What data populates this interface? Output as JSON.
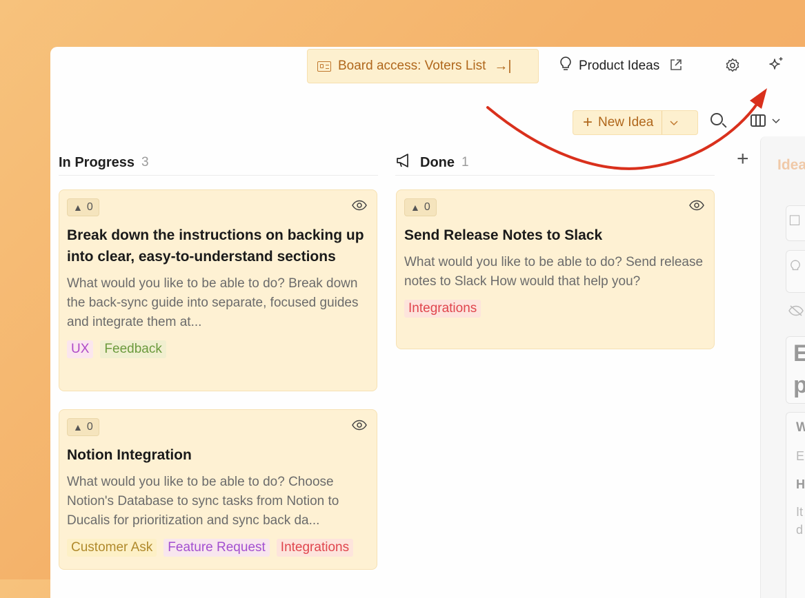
{
  "topbar": {
    "board_access_label": "Board access: Voters List",
    "board_access_icon": "id-card-icon",
    "board_access_arrow": "→|",
    "board_name": "Product Ideas",
    "board_icon": "lightbulb-icon",
    "external_icon": "external-link-icon",
    "settings_icon": "gear-icon",
    "ai_icon": "sparkle-icon"
  },
  "toolbar": {
    "new_idea_label": "New Idea",
    "search_icon": "search-icon",
    "columns_icon": "columns-icon"
  },
  "columns": [
    {
      "title": "In Progress",
      "count": "3"
    },
    {
      "title": "Done",
      "count": "1",
      "icon": "megaphone-icon"
    }
  ],
  "cards": [
    {
      "votes": "0",
      "title": "Break down the instructions on backing up into clear, easy-to-understand sections",
      "description": "What would you like to be able to do? Break down the back-sync guide into separate, focused guides and integrate them at...",
      "tags": [
        "UX",
        "Feedback"
      ]
    },
    {
      "votes": "0",
      "title": "Notion Integration",
      "description": "What would you like to be able to do? Choose Notion's Database to sync tasks from Notion to Ducalis for prioritization and sync back da...",
      "tags": [
        "Customer Ask",
        "Feature Request",
        "Integrations"
      ]
    },
    {
      "votes": "0",
      "title": "Send Release Notes to Slack",
      "description": "What would you like to be able to do? Send release notes to Slack How would that help you?",
      "tags": [
        "Integrations"
      ]
    }
  ],
  "side_panel": {
    "title": "Idea",
    "glyphs": [
      "E",
      "p",
      "W",
      "E",
      "H",
      "It",
      "d"
    ]
  },
  "colors": {
    "accent": "#b0671c",
    "arrow": "#d9301c",
    "card_bg": "#fef1d3"
  }
}
